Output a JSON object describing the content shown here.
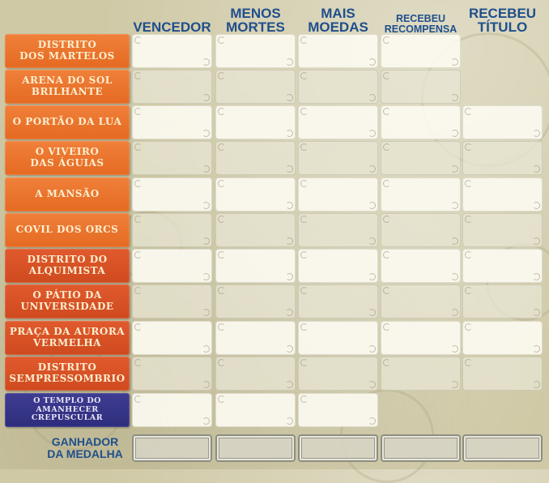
{
  "columns": [
    {
      "label": "VENCEDOR",
      "size": "big"
    },
    {
      "label": "MENOS\nMORTES",
      "size": "big"
    },
    {
      "label": "MAIS\nMOEDAS",
      "size": "big"
    },
    {
      "label": "RECEBEU\nRECOMPENSA",
      "size": "small"
    },
    {
      "label": "RECEBEU\nTÍTULO",
      "size": "big"
    }
  ],
  "rows": [
    {
      "label": "Distrito\nDos Martelos",
      "color": "orange",
      "cells": 4
    },
    {
      "label": "Arena do Sol\nBrilhante",
      "color": "orange",
      "cells": 4
    },
    {
      "label": "O Portão da Lua",
      "color": "orange",
      "cells": 5
    },
    {
      "label": "O Viveiro\ndas Águias",
      "color": "orange",
      "cells": 5
    },
    {
      "label": "A Mansão",
      "color": "orange",
      "cells": 5
    },
    {
      "label": "Covil dos Orcs",
      "color": "orange",
      "cells": 5
    },
    {
      "label": "Distrito do\nAlquimista",
      "color": "red",
      "cells": 5
    },
    {
      "label": "O Pátio da\nUniversidade",
      "color": "red",
      "cells": 5
    },
    {
      "label": "Praça da Aurora\nVermelha",
      "color": "red",
      "cells": 5
    },
    {
      "label": "Distrito\nSempressombrio",
      "color": "red",
      "cells": 5
    },
    {
      "label": "O Templo do\nAmanhecer\nCrepuscular",
      "color": "blue",
      "cells": 3,
      "small": true
    }
  ],
  "medal_row": {
    "label": "GANHADOR\nDA MEDALHA",
    "cells": 5
  },
  "colors": {
    "header_blue": "#1f4f8c",
    "orange": "#e97428",
    "red": "#d5522a",
    "blue": "#35348a",
    "parchment": "#cfc9a6"
  }
}
